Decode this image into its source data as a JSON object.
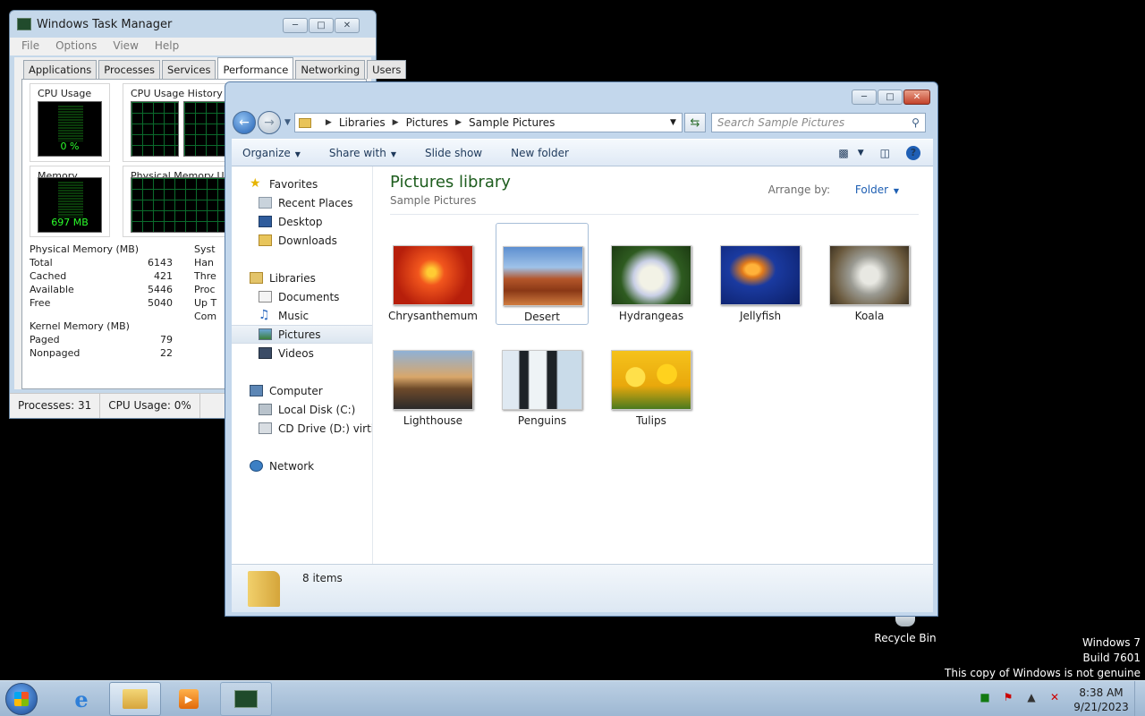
{
  "desktop": {
    "recycle_bin_label": "Recycle Bin",
    "watermark": [
      "Windows 7",
      "Build 7601",
      "This copy of Windows is not genuine"
    ]
  },
  "task_manager": {
    "title": "Windows Task Manager",
    "menu": [
      "File",
      "Options",
      "View",
      "Help"
    ],
    "tabs": [
      "Applications",
      "Processes",
      "Services",
      "Performance",
      "Networking",
      "Users"
    ],
    "active_tab": "Performance",
    "cpu_usage_label": "CPU Usage",
    "cpu_usage_value": "0 %",
    "cpu_history_label": "CPU Usage History",
    "memory_label": "Memory",
    "memory_value": "697 MB",
    "physical_memory_history_label": "Physical Memory Usa",
    "physical_memory": {
      "title": "Physical Memory (MB)",
      "rows": [
        {
          "label": "Total",
          "value": "6143"
        },
        {
          "label": "Cached",
          "value": "421"
        },
        {
          "label": "Available",
          "value": "5446"
        },
        {
          "label": "Free",
          "value": "5040"
        }
      ]
    },
    "kernel_memory": {
      "title": "Kernel Memory (MB)",
      "rows": [
        {
          "label": "Paged",
          "value": "79"
        },
        {
          "label": "Nonpaged",
          "value": "22"
        }
      ]
    },
    "system_partial": [
      "Syst",
      "Han",
      "Thre",
      "Proc",
      "Up T",
      "Com"
    ],
    "status": {
      "processes": "Processes: 31",
      "cpu": "CPU Usage: 0%"
    }
  },
  "explorer": {
    "breadcrumb": [
      "Libraries",
      "Pictures",
      "Sample Pictures"
    ],
    "search_placeholder": "Search Sample Pictures",
    "commands": [
      "Organize",
      "Share with",
      "Slide show",
      "New folder"
    ],
    "nav": {
      "favorites": "Favorites",
      "recent_places": "Recent Places",
      "desktop": "Desktop",
      "downloads": "Downloads",
      "libraries": "Libraries",
      "documents": "Documents",
      "music": "Music",
      "pictures": "Pictures",
      "videos": "Videos",
      "computer": "Computer",
      "local_disk": "Local Disk (C:)",
      "cd_drive": "CD Drive (D:) virtio-w",
      "network": "Network"
    },
    "library_title": "Pictures library",
    "library_subtitle": "Sample Pictures",
    "arrange_by_label": "Arrange by:",
    "arrange_by_value": "Folder",
    "pictures": [
      "Chrysanthemum",
      "Desert",
      "Hydrangeas",
      "Jellyfish",
      "Koala",
      "Lighthouse",
      "Penguins",
      "Tulips"
    ],
    "selected_picture": "Desert",
    "item_count": "8 items"
  },
  "taskbar": {
    "time": "8:38 AM",
    "date": "9/21/2023"
  }
}
